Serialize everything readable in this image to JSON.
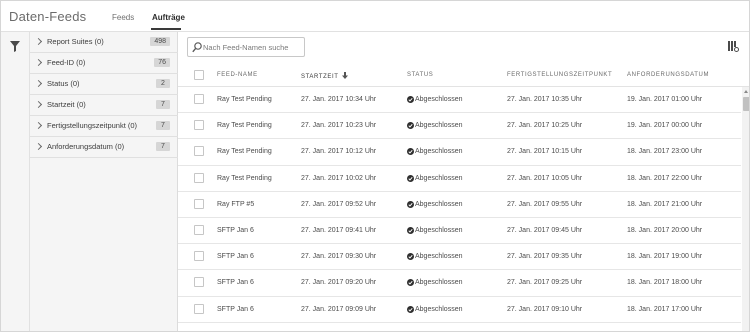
{
  "header": {
    "title": "Daten-Feeds",
    "tabs": [
      {
        "label": "Feeds",
        "active": false
      },
      {
        "label": "Aufträge",
        "active": true
      }
    ]
  },
  "filters": [
    {
      "label": "Report Suites (0)",
      "count": "498"
    },
    {
      "label": "Feed-ID (0)",
      "count": "76"
    },
    {
      "label": "Status (0)",
      "count": "2"
    },
    {
      "label": "Startzeit (0)",
      "count": "7"
    },
    {
      "label": "Fertigstellungszeitpunkt (0)",
      "count": "7"
    },
    {
      "label": "Anforderungsdatum (0)",
      "count": "7"
    }
  ],
  "search": {
    "placeholder": "Nach Feed-Namen suche",
    "value": ""
  },
  "table": {
    "columns": [
      "FEED-NAME",
      "STARTZEIT",
      "STATUS",
      "FERTIGSTELLUNGSZEITPUNKT",
      "ANFORDERUNGSDATUM"
    ],
    "sorted_column": "STARTZEIT",
    "sort_direction": "desc",
    "rows": [
      {
        "name": "Ray Test Pending",
        "start": "27. Jan. 2017 10:34 Uhr",
        "status": "Abgeschlossen",
        "done": "27. Jan. 2017 10:35 Uhr",
        "requested": "19. Jan. 2017 01:00 Uhr"
      },
      {
        "name": "Ray Test Pending",
        "start": "27. Jan. 2017 10:23 Uhr",
        "status": "Abgeschlossen",
        "done": "27. Jan. 2017 10:25 Uhr",
        "requested": "19. Jan. 2017 00:00 Uhr"
      },
      {
        "name": "Ray Test Pending",
        "start": "27. Jan. 2017 10:12 Uhr",
        "status": "Abgeschlossen",
        "done": "27. Jan. 2017 10:15 Uhr",
        "requested": "18. Jan. 2017 23:00 Uhr"
      },
      {
        "name": "Ray Test Pending",
        "start": "27. Jan. 2017 10:02 Uhr",
        "status": "Abgeschlossen",
        "done": "27. Jan. 2017 10:05 Uhr",
        "requested": "18. Jan. 2017 22:00 Uhr"
      },
      {
        "name": "Ray FTP #5",
        "start": "27. Jan. 2017 09:52 Uhr",
        "status": "Abgeschlossen",
        "done": "27. Jan. 2017 09:55 Uhr",
        "requested": "18. Jan. 2017 21:00 Uhr"
      },
      {
        "name": "SFTP Jan 6",
        "start": "27. Jan. 2017 09:41 Uhr",
        "status": "Abgeschlossen",
        "done": "27. Jan. 2017 09:45 Uhr",
        "requested": "18. Jan. 2017 20:00 Uhr"
      },
      {
        "name": "SFTP Jan 6",
        "start": "27. Jan. 2017 09:30 Uhr",
        "status": "Abgeschlossen",
        "done": "27. Jan. 2017 09:35 Uhr",
        "requested": "18. Jan. 2017 19:00 Uhr"
      },
      {
        "name": "SFTP Jan 6",
        "start": "27. Jan. 2017 09:20 Uhr",
        "status": "Abgeschlossen",
        "done": "27. Jan. 2017 09:25 Uhr",
        "requested": "18. Jan. 2017 18:00 Uhr"
      },
      {
        "name": "SFTP Jan 6",
        "start": "27. Jan. 2017 09:09 Uhr",
        "status": "Abgeschlossen",
        "done": "27. Jan. 2017 09:10 Uhr",
        "requested": "18. Jan. 2017 17:00 Uhr"
      }
    ]
  },
  "icons": {
    "filter": "filter-icon",
    "search": "search-icon",
    "columns": "column-settings-icon",
    "status": "check-circle-icon",
    "sort": "sort-down-arrow-icon"
  },
  "colors": {
    "accent": "#3a3a3a",
    "panel": "#f5f5f5",
    "badge": "#d6d6d6"
  }
}
